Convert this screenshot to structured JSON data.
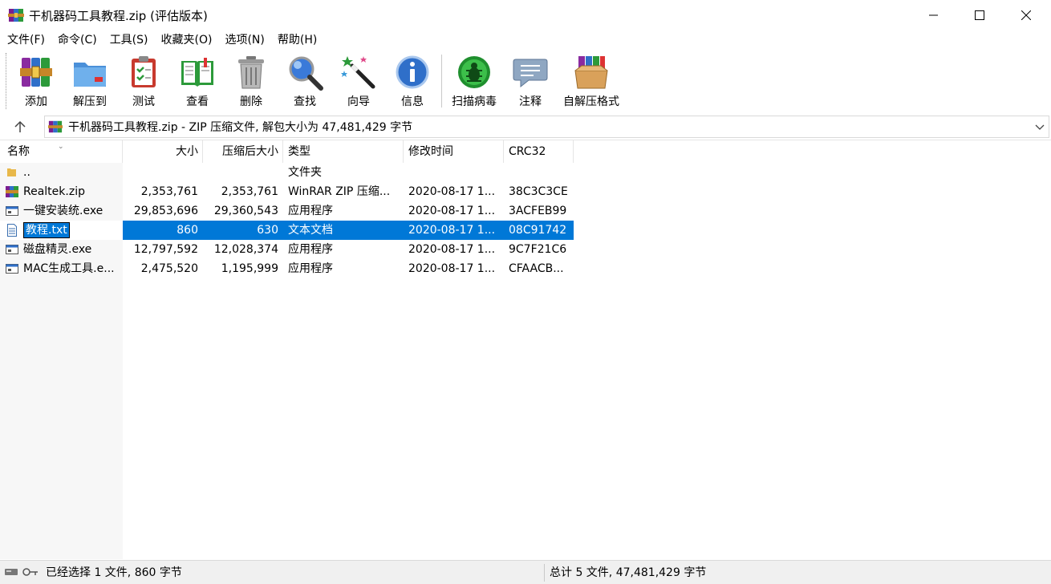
{
  "window": {
    "title": "干机器码工具教程.zip (评估版本)"
  },
  "menu": [
    "文件(F)",
    "命令(C)",
    "工具(S)",
    "收藏夹(O)",
    "选项(N)",
    "帮助(H)"
  ],
  "toolbar": {
    "add": "添加",
    "extract_to": "解压到",
    "test": "测试",
    "view": "查看",
    "delete": "删除",
    "find": "查找",
    "wizard": "向导",
    "info": "信息",
    "virus_scan": "扫描病毒",
    "comment": "注释",
    "sfx": "自解压格式"
  },
  "address": {
    "text": "干机器码工具教程.zip - ZIP 压缩文件, 解包大小为 47,481,429 字节"
  },
  "columns": {
    "name": "名称",
    "size": "大小",
    "packed": "压缩后大小",
    "type": "类型",
    "modified": "修改时间",
    "crc": "CRC32"
  },
  "files": [
    {
      "icon": "folder-up-icon",
      "name": "..",
      "size": "",
      "packed": "",
      "type": "文件夹",
      "modified": "",
      "crc": ""
    },
    {
      "icon": "winrar-zip-icon",
      "name": "Realtek.zip",
      "size": "2,353,761",
      "packed": "2,353,761",
      "type": "WinRAR ZIP 压缩...",
      "modified": "2020-08-17 1...",
      "crc": "38C3C3CE"
    },
    {
      "icon": "exe-icon",
      "name": "一键安装统.exe",
      "size": "29,853,696",
      "packed": "29,360,543",
      "type": "应用程序",
      "modified": "2020-08-17 1...",
      "crc": "3ACFEB99"
    },
    {
      "icon": "text-file-icon",
      "name": "教程.txt",
      "size": "860",
      "packed": "630",
      "type": "文本文档",
      "modified": "2020-08-17 1...",
      "crc": "08C91742",
      "selected": true
    },
    {
      "icon": "exe-icon",
      "name": "磁盘精灵.exe",
      "size": "12,797,592",
      "packed": "12,028,374",
      "type": "应用程序",
      "modified": "2020-08-17 1...",
      "crc": "9C7F21C6"
    },
    {
      "icon": "exe-icon",
      "name": "MAC生成工具.e...",
      "size": "2,475,520",
      "packed": "1,195,999",
      "type": "应用程序",
      "modified": "2020-08-17 1...",
      "crc": "CFAACB..."
    }
  ],
  "status": {
    "left": "已经选择 1 文件, 860 字节",
    "right": "总计 5 文件, 47,481,429 字节"
  },
  "colors": {
    "selection": "#0078d7",
    "name_column_bg": "#f7f7f7",
    "status_bg": "#f0f0f0"
  }
}
